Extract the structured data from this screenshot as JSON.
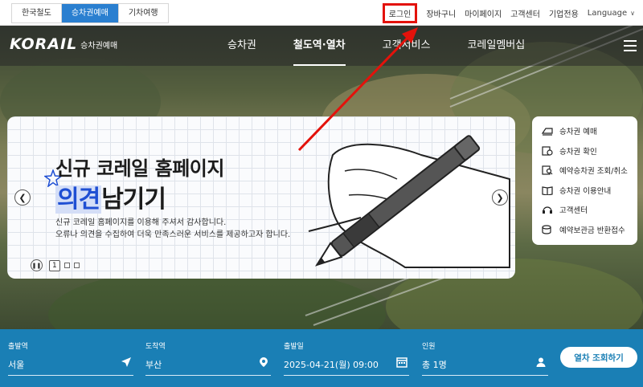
{
  "util_bar": {
    "site_tabs": [
      {
        "label": "한국철도",
        "active": false
      },
      {
        "label": "승차권예매",
        "active": true
      },
      {
        "label": "기차여행",
        "active": false
      }
    ],
    "links": {
      "login": "로그인",
      "cart": "장바구니",
      "mypage": "마이페이지",
      "support": "고객센터",
      "business": "기업전용",
      "language": "Language"
    }
  },
  "nav": {
    "logo_mark": "KORAIL",
    "logo_sub": "승차권예매",
    "items": [
      "승차권",
      "철도역·열차",
      "고객서비스",
      "코레일멤버십"
    ],
    "active_index": 1
  },
  "banner": {
    "title_line1": "신규 코레일 홈페이지",
    "title_highlight": "의견",
    "title_rest": "남기기",
    "desc_line1": "신규 코레일 홈페이지를 이용해 주셔서 감사합니다.",
    "desc_line2": "오류나 의견을 수집하여 더욱 만족스러운 서비스를 제공하고자 합니다.",
    "current_page": "1",
    "page_count": 3
  },
  "quick_menu": [
    {
      "label": "승차권 예매",
      "icon": "train-ticket-icon"
    },
    {
      "label": "승차권 확인",
      "icon": "ticket-check-icon"
    },
    {
      "label": "예약승차권 조회/취소",
      "icon": "reservation-search-icon"
    },
    {
      "label": "승차권 이용안내",
      "icon": "guide-book-icon"
    },
    {
      "label": "고객센터",
      "icon": "headset-icon"
    },
    {
      "label": "예약보관금 반환접수",
      "icon": "coins-icon"
    }
  ],
  "search": {
    "departure": {
      "label": "출발역",
      "value": "서울"
    },
    "arrival": {
      "label": "도착역",
      "value": "부산"
    },
    "date": {
      "label": "출발일",
      "value": "2025-04-21(월) 09:00"
    },
    "passengers": {
      "label": "인원",
      "value": "총 1명"
    },
    "submit_label": "열차 조회하기"
  },
  "colors": {
    "brand_blue": "#1a7fb5",
    "tab_active": "#2a7fd0",
    "annotation_red": "#e3120b",
    "highlight_blue": "#1f4fd3"
  }
}
